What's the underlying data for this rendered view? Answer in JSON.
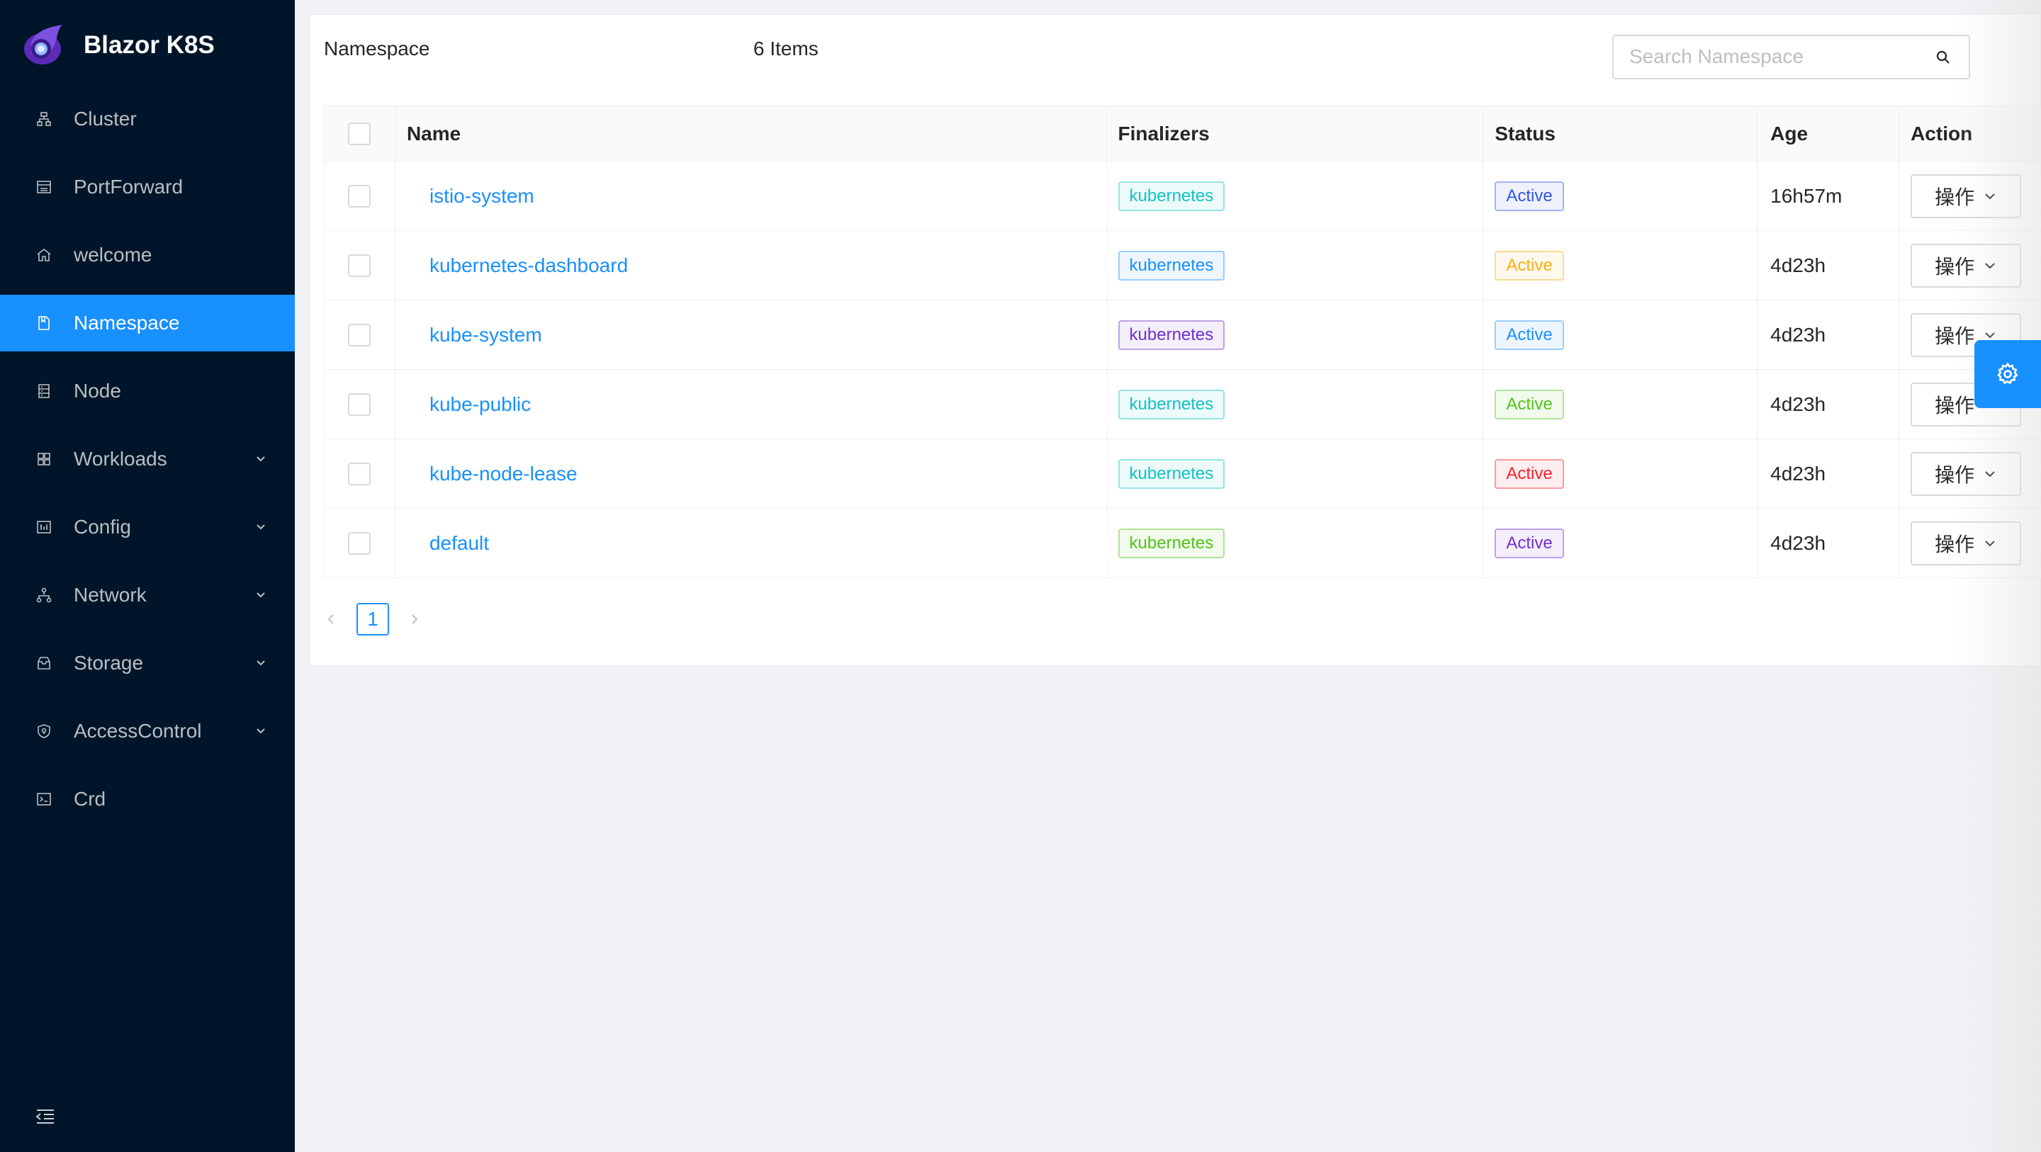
{
  "app": {
    "title": "Blazor K8S"
  },
  "sidebar": {
    "items": [
      {
        "label": "Cluster",
        "icon": "cluster-icon",
        "active": false,
        "submenu": false
      },
      {
        "label": "PortForward",
        "icon": "port-forward-icon",
        "active": false,
        "submenu": false
      },
      {
        "label": "welcome",
        "icon": "home-icon",
        "active": false,
        "submenu": false
      },
      {
        "label": "Namespace",
        "icon": "namespace-icon",
        "active": true,
        "submenu": false
      },
      {
        "label": "Node",
        "icon": "node-icon",
        "active": false,
        "submenu": false
      },
      {
        "label": "Workloads",
        "icon": "workloads-icon",
        "active": false,
        "submenu": true
      },
      {
        "label": "Config",
        "icon": "config-icon",
        "active": false,
        "submenu": true
      },
      {
        "label": "Network",
        "icon": "network-icon",
        "active": false,
        "submenu": true
      },
      {
        "label": "Storage",
        "icon": "storage-icon",
        "active": false,
        "submenu": true
      },
      {
        "label": "AccessControl",
        "icon": "access-control-icon",
        "active": false,
        "submenu": true
      },
      {
        "label": "Crd",
        "icon": "crd-icon",
        "active": false,
        "submenu": false
      }
    ]
  },
  "page": {
    "title": "Namespace",
    "count": "6 Items",
    "search": {
      "placeholder": "Search Namespace",
      "value": ""
    }
  },
  "table": {
    "columns": [
      "Name",
      "Finalizers",
      "Status",
      "Age",
      "Action"
    ],
    "rows": [
      {
        "name": "istio-system",
        "finalizer": "kubernetes",
        "status": "Active",
        "age": "16h57m",
        "action": "操作",
        "finalizer_color": "#13c2c2",
        "status_color": "#2f54eb"
      },
      {
        "name": "kubernetes-dashboard",
        "finalizer": "kubernetes",
        "status": "Active",
        "age": "4d23h",
        "action": "操作",
        "finalizer_color": "#1890ff",
        "status_color": "#faad14"
      },
      {
        "name": "kube-system",
        "finalizer": "kubernetes",
        "status": "Active",
        "age": "4d23h",
        "action": "操作",
        "finalizer_color": "#722ed1",
        "status_color": "#1890ff"
      },
      {
        "name": "kube-public",
        "finalizer": "kubernetes",
        "status": "Active",
        "age": "4d23h",
        "action": "操作",
        "finalizer_color": "#13c2c2",
        "status_color": "#52c41a"
      },
      {
        "name": "kube-node-lease",
        "finalizer": "kubernetes",
        "status": "Active",
        "age": "4d23h",
        "action": "操作",
        "finalizer_color": "#13c2c2",
        "status_color": "#f5222d"
      },
      {
        "name": "default",
        "finalizer": "kubernetes",
        "status": "Active",
        "age": "4d23h",
        "action": "操作",
        "finalizer_color": "#52c41a",
        "status_color": "#722ed1"
      }
    ]
  },
  "pagination": {
    "current": "1"
  },
  "colors": {
    "sidebar_bg": "#001529",
    "primary": "#1890ff",
    "logo": "#6b3fd4"
  }
}
